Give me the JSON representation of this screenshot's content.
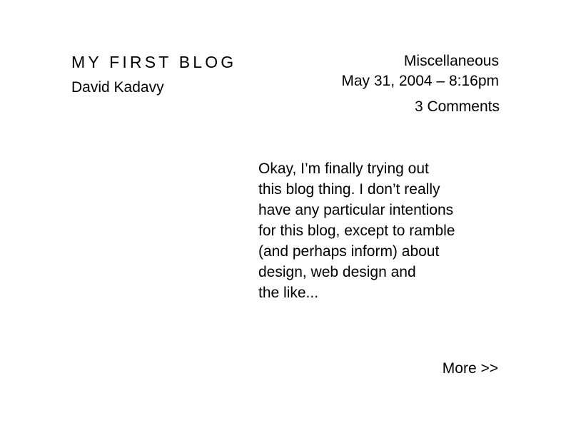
{
  "post": {
    "title": "MY FIRST BLOG",
    "author": "David Kadavy",
    "category": "Miscellaneous",
    "date": "May 31, 2004 – 8:16pm",
    "comments": "3 Comments",
    "excerpt_lines": [
      "Okay, I’m finally trying out",
      "this blog thing. I don’t really",
      "have any particular intentions",
      "for this blog, except to ramble",
      "(and perhaps inform) about",
      "design, web design and",
      "the like..."
    ],
    "more": "More >>"
  }
}
